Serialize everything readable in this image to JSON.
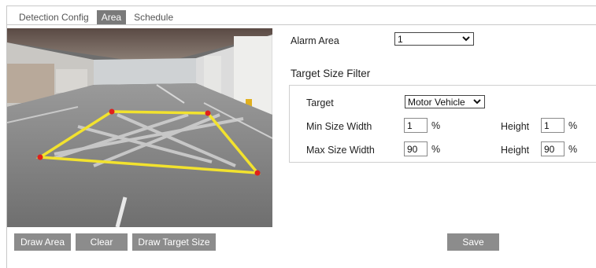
{
  "tabs": [
    {
      "label": "Detection Config",
      "active": false
    },
    {
      "label": "Area",
      "active": true
    },
    {
      "label": "Schedule",
      "active": false
    }
  ],
  "buttons": {
    "draw_area": "Draw Area",
    "clear": "Clear",
    "draw_target_size": "Draw Target Size",
    "save": "Save"
  },
  "alarm_area": {
    "label": "Alarm Area",
    "value": "1"
  },
  "target_size_filter": {
    "title": "Target Size Filter",
    "target_label": "Target",
    "target_value": "Motor Vehicle",
    "min_label": "Min Size Width",
    "min_width": "1",
    "max_label": "Max Size Width",
    "max_width": "90",
    "height_label": "Height",
    "min_height": "1",
    "max_height": "90",
    "unit": "%"
  },
  "colors": {
    "area_line": "#f2e22e",
    "vertex": "#e0201b",
    "button_bg": "#8c8c8c",
    "tab_active_bg": "#7a7a7a"
  }
}
